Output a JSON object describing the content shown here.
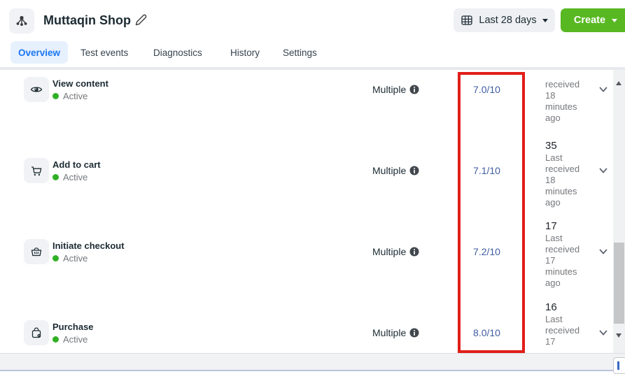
{
  "header": {
    "title": "Muttaqin Shop",
    "date_range": "Last 28 days",
    "create": "Create"
  },
  "tabs": {
    "overview": "Overview",
    "test_events": "Test events",
    "diagnostics": "Diagnostics",
    "history": "History",
    "settings": "Settings"
  },
  "events": {
    "rows": [
      {
        "icon": "eye-icon",
        "name": "View content",
        "status": "Active",
        "connection": "Multiple",
        "score": "7.0/10",
        "detail_lines": [
          "received",
          "18",
          "minutes",
          "ago"
        ]
      },
      {
        "icon": "cart-icon",
        "name": "Add to cart",
        "status": "Active",
        "connection": "Multiple",
        "score": "7.1/10",
        "detail_lines": [
          "35",
          "Last",
          "received",
          "18",
          "minutes",
          "ago"
        ]
      },
      {
        "icon": "basket-icon",
        "name": "Initiate checkout",
        "status": "Active",
        "connection": "Multiple",
        "score": "7.2/10",
        "detail_lines": [
          "17",
          "Last",
          "received",
          "17",
          "minutes",
          "ago"
        ]
      },
      {
        "icon": "bag-icon",
        "name": "Purchase",
        "status": "Active",
        "connection": "Multiple",
        "score": "8.0/10",
        "detail_lines": [
          "16",
          "Last",
          "received",
          "17"
        ]
      }
    ]
  },
  "colors": {
    "accent_blue": "#1877f2",
    "score_blue": "#3e5ca0",
    "highlight_red": "#e11e19",
    "create_green": "#58b822",
    "active_green": "#31b025"
  }
}
